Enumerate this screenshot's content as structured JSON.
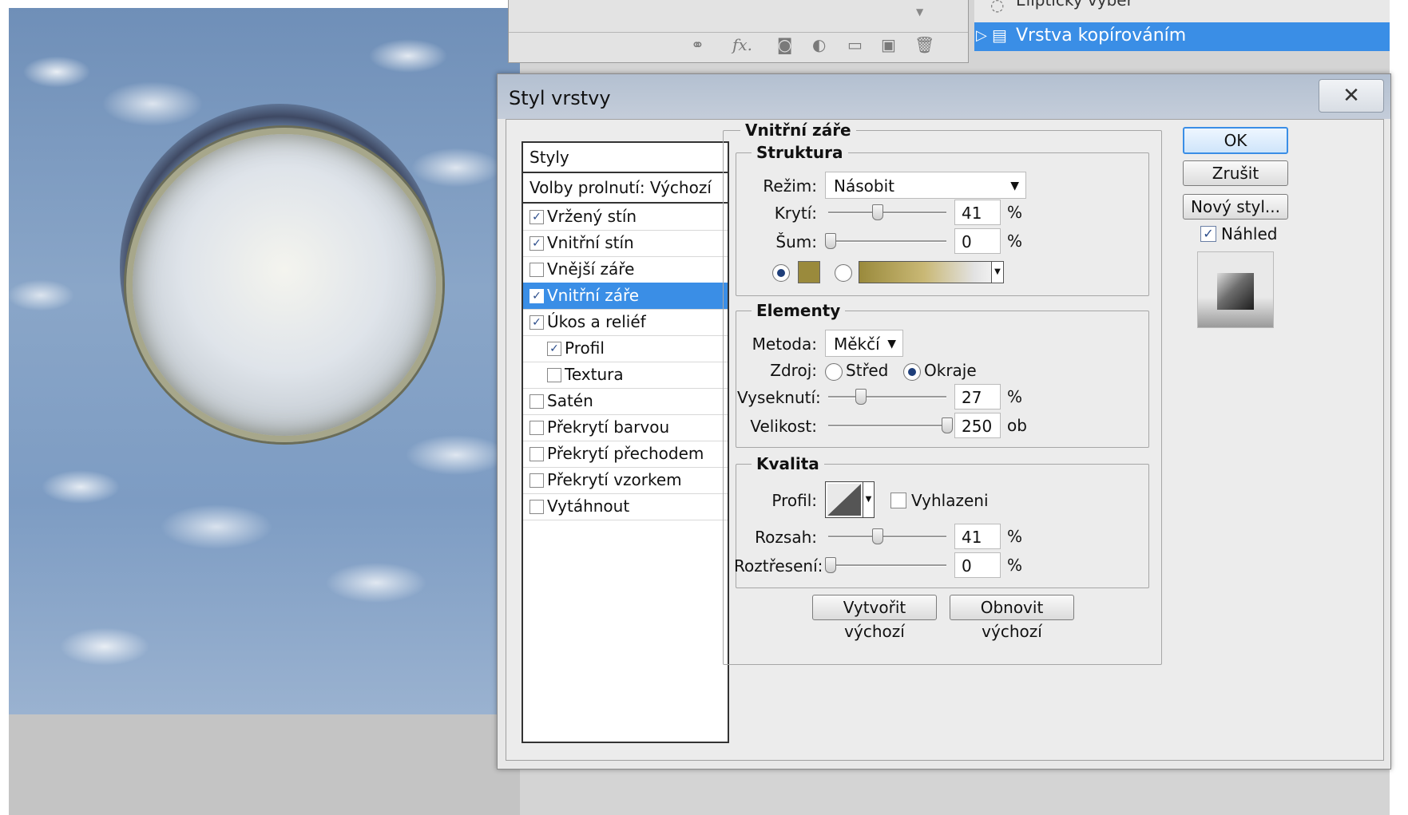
{
  "layers": {
    "previous_layer": "Eliptický výběr",
    "selected_layer": "Vrstva kopírováním",
    "toolbar_icons": [
      "link-icon",
      "fx-icon",
      "mask-icon",
      "adjustment-icon",
      "folder-icon",
      "new-layer-icon",
      "trash-icon"
    ],
    "fx_label": "fx."
  },
  "dialog": {
    "title": "Styl vrstvy",
    "close_glyph": "✕",
    "styles_header": "Styly",
    "blend_options": "Volby prolnutí: Výchozí",
    "styles": [
      {
        "label": "Vržený stín",
        "checked": true
      },
      {
        "label": "Vnitřní stín",
        "checked": true
      },
      {
        "label": "Vnější záře",
        "checked": false
      },
      {
        "label": "Vnitřní záře",
        "checked": true,
        "selected": true
      },
      {
        "label": "Úkos a reliéf",
        "checked": true
      },
      {
        "label": "Profil",
        "checked": true,
        "indent": true
      },
      {
        "label": "Textura",
        "checked": false,
        "indent": true
      },
      {
        "label": "Satén",
        "checked": false
      },
      {
        "label": "Překrytí barvou",
        "checked": false
      },
      {
        "label": "Překrytí přechodem",
        "checked": false
      },
      {
        "label": "Překrytí vzorkem",
        "checked": false
      },
      {
        "label": "Vytáhnout",
        "checked": false
      }
    ],
    "section_title": "Vnitřní záře",
    "structure": {
      "title": "Struktura",
      "mode_label": "Režim:",
      "mode_value": "Násobit",
      "opacity_label": "Krytí:",
      "opacity_value": "41",
      "noise_label": "Šum:",
      "noise_value": "0",
      "percent": "%",
      "color": "#9a8a3c"
    },
    "elements": {
      "title": "Elementy",
      "method_label": "Metoda:",
      "method_value": "Měkčí",
      "source_label": "Zdroj:",
      "source_center": "Střed",
      "source_edge": "Okraje",
      "choke_label": "Vyseknutí:",
      "choke_value": "27",
      "size_label": "Velikost:",
      "size_value": "250",
      "size_unit": "ob"
    },
    "quality": {
      "title": "Kvalita",
      "contour_label": "Profil:",
      "antialias_label": "Vyhlazeni",
      "range_label": "Rozsah:",
      "range_value": "41",
      "jitter_label": "Roztřesení:",
      "jitter_value": "0"
    },
    "make_default": "Vytvořit výchozí",
    "reset_default": "Obnovit výchozí",
    "ok": "OK",
    "cancel": "Zrušit",
    "new_style": "Nový styl...",
    "preview": "Náhled",
    "accent": "#3a8ee6"
  }
}
